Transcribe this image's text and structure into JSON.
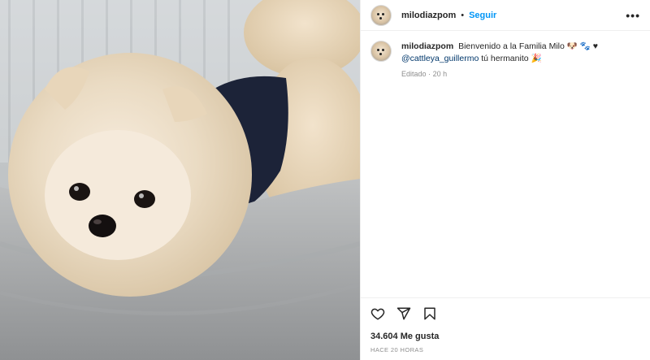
{
  "post": {
    "username": "milodiazpom",
    "separator": "•",
    "follow_label": "Seguir",
    "more_icon": "more-horizontal-icon",
    "caption": {
      "username": "milodiazpom",
      "text": "Bienvenido a la Familia Milo 🐶 🐾 ♥",
      "mention": "@cattleya_guillermo",
      "text_after_mention": " tú hermanito 🎉",
      "edited_label": "Editado",
      "meta_separator": "·",
      "time_ago": "20 h"
    },
    "likes": "34.604 Me gusta",
    "timestamp": "HACE 20 HORAS",
    "icons": {
      "like": "heart-icon",
      "share": "send-icon",
      "save": "bookmark-icon"
    },
    "colors": {
      "accent": "#0095f6",
      "mention": "#00376b",
      "muted": "#8e8e8e"
    }
  }
}
